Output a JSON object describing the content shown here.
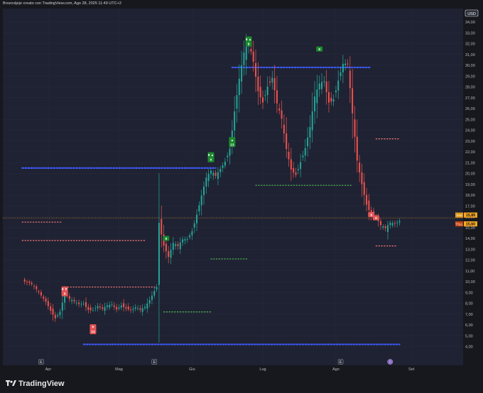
{
  "header": {
    "caption": "Brozovljeje creato con TradingView.com, Ago 28, 2025 11:49 UTC+2"
  },
  "footer": {
    "brand": "TradingView"
  },
  "colors": {
    "background": "#1f2232",
    "up": "#26a69a",
    "down": "#ef5350",
    "resistance": "#3d5afe",
    "support": "#4caf50",
    "risk": "#e57373",
    "price_tag": "#f5a623"
  },
  "chart_data": {
    "type": "candlestick",
    "currency": "USD",
    "ylim": [
      3.5,
      34.5
    ],
    "y_ticks": [
      "4,00",
      "5,00",
      "6,00",
      "7,00",
      "8,00",
      "9,00",
      "10,00",
      "11,00",
      "12,00",
      "13,00",
      "14,00",
      "15,00",
      "16,00",
      "17,00",
      "18,00",
      "19,00",
      "20,00",
      "21,00",
      "22,00",
      "23,00",
      "24,00",
      "25,00",
      "26,00",
      "27,00",
      "28,00",
      "29,00",
      "30,00",
      "31,00",
      "32,00",
      "33,00",
      "34,00"
    ],
    "x_labels": [
      {
        "label": "Apr",
        "day": 9
      },
      {
        "label": "Mag",
        "day": 39
      },
      {
        "label": "Giu",
        "day": 70
      },
      {
        "label": "Lug",
        "day": 100
      },
      {
        "label": "Ago",
        "day": 131
      },
      {
        "label": "Set",
        "day": 163
      }
    ],
    "x_domain": [
      0,
      185
    ],
    "price_labels": [
      {
        "label": "Inst",
        "value": "15,89",
        "y": 15.89
      },
      {
        "label": "TSLL",
        "value": "15,60",
        "y": 15.6
      }
    ],
    "series": [
      {
        "name": "TSLL",
        "points": [
          [
            -2,
            10.2
          ],
          [
            0,
            10.0
          ],
          [
            2,
            9.6
          ],
          [
            4,
            9.1
          ],
          [
            6,
            8.6
          ],
          [
            8,
            8.2
          ],
          [
            10,
            7.5
          ],
          [
            12,
            6.8
          ],
          [
            14,
            7.3
          ],
          [
            16,
            8.8
          ],
          [
            18,
            8.2
          ],
          [
            20,
            8.0
          ],
          [
            22,
            7.9
          ],
          [
            24,
            8.1
          ],
          [
            26,
            7.6
          ],
          [
            28,
            7.5
          ],
          [
            30,
            7.7
          ],
          [
            32,
            7.3
          ],
          [
            34,
            7.6
          ],
          [
            36,
            7.8
          ],
          [
            38,
            7.5
          ],
          [
            40,
            8.0
          ],
          [
            42,
            7.7
          ],
          [
            44,
            7.4
          ],
          [
            46,
            7.5
          ],
          [
            48,
            7.2
          ],
          [
            50,
            7.5
          ],
          [
            52,
            8.3
          ],
          [
            54,
            9.3
          ],
          [
            55,
            9.7
          ],
          [
            56,
            15.8
          ],
          [
            58,
            13.5
          ],
          [
            60,
            12.2
          ],
          [
            62,
            13.3
          ],
          [
            64,
            13.0
          ],
          [
            66,
            13.8
          ],
          [
            68,
            14.1
          ],
          [
            70,
            15.0
          ],
          [
            72,
            16.5
          ],
          [
            74,
            18.0
          ],
          [
            76,
            19.3
          ],
          [
            78,
            19.8
          ],
          [
            80,
            19.5
          ],
          [
            82,
            20.5
          ],
          [
            84,
            21.5
          ],
          [
            86,
            22.8
          ],
          [
            88,
            26.0
          ],
          [
            90,
            28.5
          ],
          [
            92,
            30.5
          ],
          [
            94,
            31.5
          ],
          [
            96,
            30.2
          ],
          [
            98,
            28.0
          ],
          [
            100,
            27.2
          ],
          [
            102,
            28.5
          ],
          [
            104,
            28.8
          ],
          [
            106,
            26.0
          ],
          [
            108,
            24.5
          ],
          [
            110,
            22.0
          ],
          [
            112,
            20.5
          ],
          [
            114,
            20.3
          ],
          [
            116,
            21.5
          ],
          [
            118,
            22.5
          ],
          [
            120,
            24.0
          ],
          [
            122,
            26.5
          ],
          [
            124,
            27.8
          ],
          [
            126,
            28.5
          ],
          [
            128,
            27.0
          ],
          [
            130,
            27.5
          ],
          [
            132,
            29.0
          ],
          [
            134,
            30.0
          ],
          [
            136,
            29.5
          ],
          [
            138,
            25.0
          ],
          [
            140,
            21.0
          ],
          [
            142,
            19.2
          ],
          [
            144,
            17.5
          ],
          [
            146,
            16.5
          ],
          [
            148,
            16.0
          ],
          [
            150,
            15.0
          ],
          [
            152,
            14.6
          ],
          [
            154,
            15.2
          ],
          [
            156,
            15.4
          ],
          [
            158,
            15.89
          ]
        ]
      }
    ],
    "levels": [
      {
        "name": "resistance",
        "y": 29.8,
        "x": [
          87,
          146
        ]
      },
      {
        "name": "resistance",
        "y": 20.5,
        "x": [
          -2,
          80
        ]
      },
      {
        "name": "resistance",
        "y": 4.2,
        "x": [
          24,
          158
        ]
      },
      {
        "name": "support",
        "y": 18.9,
        "x": [
          97,
          138
        ]
      },
      {
        "name": "support",
        "y": 12.1,
        "x": [
          78,
          94
        ]
      },
      {
        "name": "support",
        "y": 7.2,
        "x": [
          58,
          78
        ]
      },
      {
        "name": "risk",
        "y": 15.5,
        "x": [
          -2,
          15
        ]
      },
      {
        "name": "risk",
        "y": 13.8,
        "x": [
          -2,
          50
        ]
      },
      {
        "name": "risk",
        "y": 9.5,
        "x": [
          15,
          55
        ]
      },
      {
        "name": "risk",
        "y": 23.2,
        "x": [
          148,
          158
        ]
      },
      {
        "name": "risk",
        "y": 13.3,
        "x": [
          148,
          157
        ]
      }
    ],
    "signals": [
      {
        "day": 94,
        "y": 32.2,
        "color": "green",
        "text": "8 ▲",
        "sub": "9"
      },
      {
        "day": 124,
        "y": 31.5,
        "color": "green",
        "text": "8",
        "sub": ""
      },
      {
        "day": 78,
        "y": 21.5,
        "color": "green",
        "text": "8 ▲",
        "sub": "9"
      },
      {
        "day": 87,
        "y": 22.9,
        "color": "green",
        "text": "▲",
        "sub": "13"
      },
      {
        "day": 59,
        "y": 14.0,
        "color": "green",
        "text": "9",
        "sub": ""
      },
      {
        "day": 16,
        "y": 9.1,
        "color": "red",
        "text": "8 ▼",
        "sub": "9"
      },
      {
        "day": 28,
        "y": 5.6,
        "color": "red",
        "text": "▼",
        "sub": "13"
      },
      {
        "day": 146,
        "y": 16.2,
        "color": "red",
        "text": "8",
        "sub": ""
      },
      {
        "day": 148,
        "y": 15.9,
        "color": "red",
        "text": "9",
        "sub": ""
      }
    ],
    "event_markers": [
      {
        "day": 6,
        "text": "E"
      },
      {
        "day": 54,
        "text": "E"
      },
      {
        "day": 133,
        "text": "E"
      },
      {
        "day": 154,
        "text": "D"
      }
    ]
  }
}
